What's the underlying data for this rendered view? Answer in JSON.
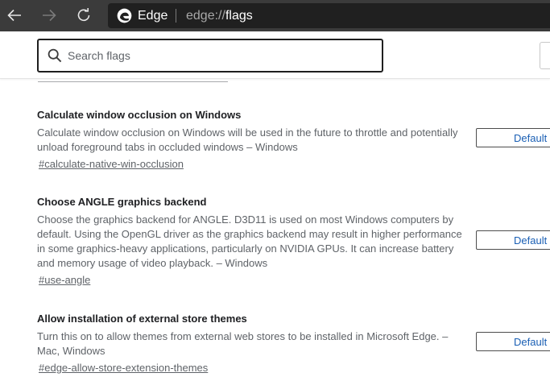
{
  "browser": {
    "site_name": "Edge",
    "url_scheme": "edge://",
    "url_path": "flags",
    "icons": {
      "back": "arrow-left-icon",
      "forward": "arrow-right-icon",
      "refresh": "refresh-icon",
      "logo": "edge-logo-icon"
    }
  },
  "search": {
    "placeholder": "Search flags",
    "value": ""
  },
  "flags": [
    {
      "title": "Calculate window occlusion on Windows",
      "description": "Calculate window occlusion on Windows will be used in the future to throttle and potentially unload foreground tabs in occluded windows – Windows",
      "link": "#calculate-native-win-occlusion",
      "value": "Default"
    },
    {
      "title": "Choose ANGLE graphics backend",
      "description": "Choose the graphics backend for ANGLE. D3D11 is used on most Windows computers by default. Using the OpenGL driver as the graphics backend may result in higher performance in some graphics-heavy applications, particularly on NVIDIA GPUs. It can increase battery and memory usage of video playback. – Windows",
      "link": "#use-angle",
      "value": "Default"
    },
    {
      "title": "Allow installation of external store themes",
      "description": "Turn this on to allow themes from external web stores to be installed in Microsoft Edge. – Mac, Windows",
      "link": "#edge-allow-store-extension-themes",
      "value": "Default"
    }
  ],
  "colors": {
    "titlebar": "#3b3b3b",
    "addressbar": "#202020",
    "select_text": "#1a5fb4"
  }
}
